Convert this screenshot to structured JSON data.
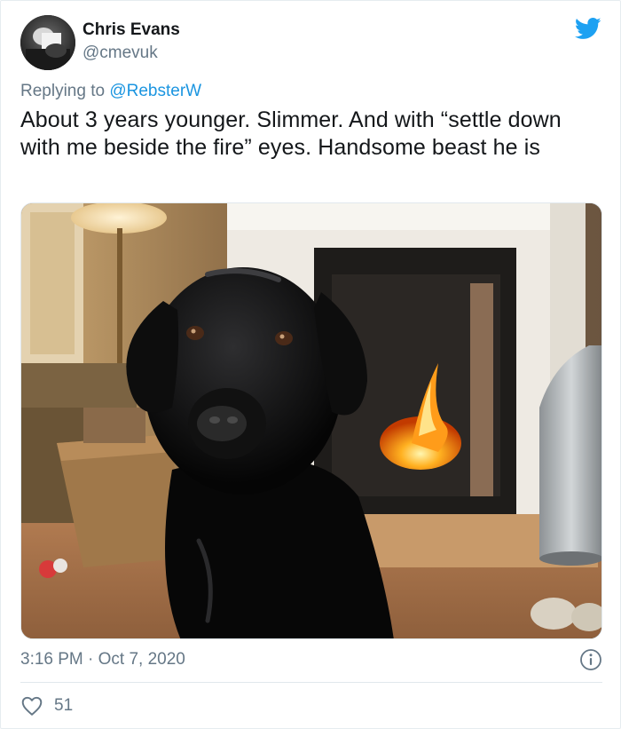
{
  "author": {
    "name": "Chris Evans",
    "handle": "@cmevuk"
  },
  "reply": {
    "prefix": "Replying to ",
    "mention": "@RebsterW"
  },
  "tweet": {
    "text": "About 3 years younger. Slimmer. And with “settle down with me beside the fire” eyes. Handsome beast he is"
  },
  "meta": {
    "timestamp": "3:16 PM · Oct 7, 2020"
  },
  "actions": {
    "like_count": "51"
  },
  "icons": {
    "brand": "twitter-bird-icon",
    "info": "info-icon",
    "like": "heart-icon"
  },
  "colors": {
    "brand_blue": "#1da1f2",
    "mention_blue": "#1b95e0",
    "secondary_text": "#657786"
  }
}
